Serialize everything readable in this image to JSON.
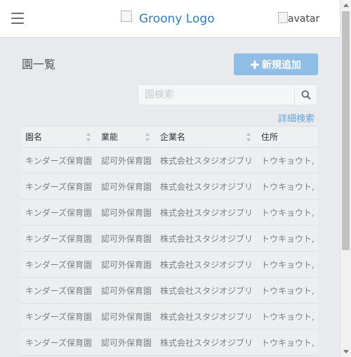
{
  "header": {
    "menu_icon": "hamburger-menu-icon",
    "logo_alt": "Groony Logo",
    "avatar_alt": "avatar"
  },
  "page": {
    "title": "園一覧",
    "add_button_label": "新規追加",
    "add_button_icon": "plus-icon",
    "search_placeholder": "園検索",
    "search_icon": "search-icon",
    "detail_search_link": "詳細検索"
  },
  "colors": {
    "accent": "#8fbde6",
    "link": "#5fa4de",
    "logo": "#2f7ec3"
  },
  "table": {
    "headers": [
      "園名",
      "業能",
      "企業名",
      "住所"
    ],
    "rows": [
      [
        "キンダーズ保育園",
        "認可外保育園",
        "株式会社スタジオジブリ",
        "トウキョウト, ..."
      ],
      [
        "キンダーズ保育園",
        "認可外保育園",
        "株式会社スタジオジブリ",
        "トウキョウト, ..."
      ],
      [
        "キンダーズ保育園",
        "認可外保育園",
        "株式会社スタジオジブリ",
        "トウキョウト, ..."
      ],
      [
        "キンダーズ保育園",
        "認可外保育園",
        "株式会社スタジオジブリ",
        "トウキョウト, ..."
      ],
      [
        "キンダーズ保育園",
        "認可外保育園",
        "株式会社スタジオジブリ",
        "トウキョウト, ..."
      ],
      [
        "キンダーズ保育園",
        "認可外保育園",
        "株式会社スタジオジブリ",
        "トウキョウト, ..."
      ],
      [
        "キンダーズ保育園",
        "認可外保育園",
        "株式会社スタジオジブリ",
        "トウキョウト, ..."
      ],
      [
        "キンダーズ保育園",
        "認可外保育園",
        "株式会社スタジオジブリ",
        "トウキョウト, ..."
      ]
    ]
  }
}
